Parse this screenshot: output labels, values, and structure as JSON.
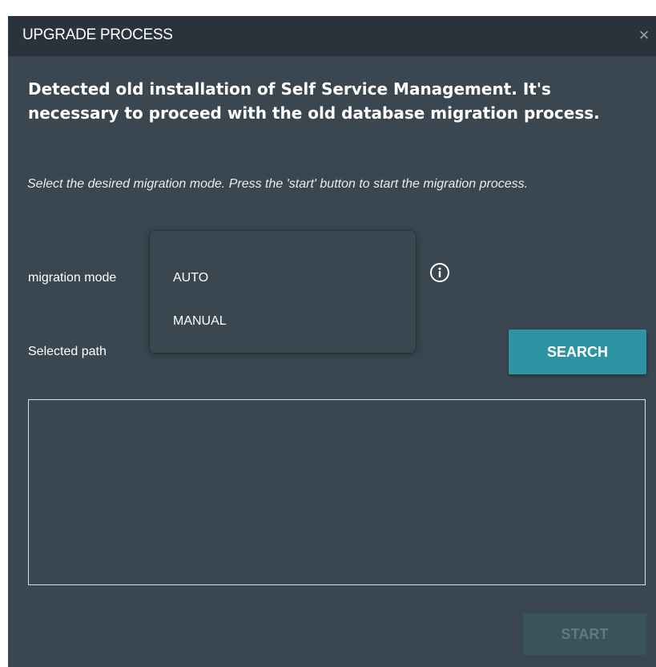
{
  "dialog": {
    "title": "UPGRADE PROCESS",
    "close_symbol": "×",
    "heading": "Detected old installation of Self Service Management. It's necessary to proceed with the old database migration process.",
    "hint": "Select the desired migration mode. Press the 'start' button to start the migration process."
  },
  "form": {
    "migration_mode_label": "migration mode",
    "migration_mode_options": [
      "AUTO",
      "MANUAL"
    ],
    "info_icon": "info-circle-icon",
    "selected_path_label": "Selected path",
    "selected_path_value": "",
    "search_label": "SEARCH"
  },
  "footer": {
    "start_label": "START",
    "start_enabled": false
  },
  "colors": {
    "dialog_bg": "#3a4750",
    "titlebar_bg": "#2a333b",
    "accent": "#2e93a3",
    "disabled_button": "#3a5259"
  }
}
